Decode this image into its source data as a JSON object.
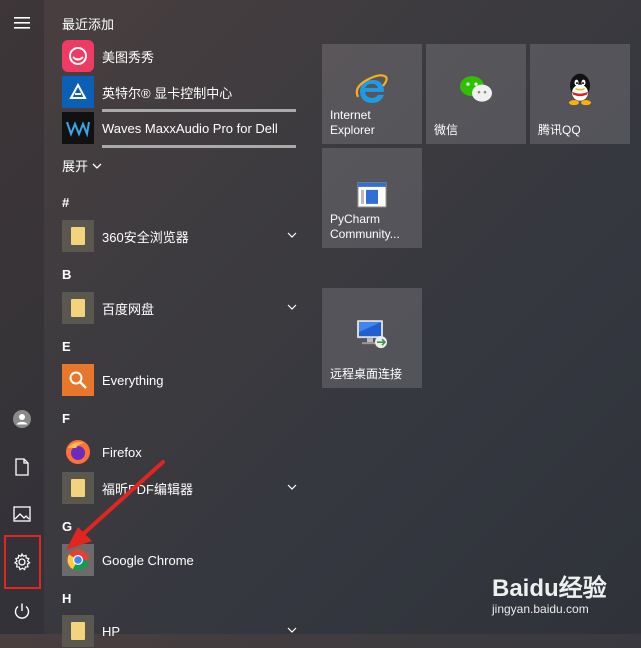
{
  "start_menu": {
    "recently_added_title": "最近添加",
    "recent_items": [
      {
        "label": "美图秀秀",
        "icon": "meitu-icon"
      },
      {
        "label": "英特尔® 显卡控制中心",
        "icon": "intel-graphics-icon"
      },
      {
        "label": "Waves MaxxAudio Pro for Dell",
        "icon": "waves-maxxaudio-icon"
      }
    ],
    "expand_label": "展开",
    "groups": [
      {
        "letter": "#",
        "items": [
          {
            "label": "360安全浏览器",
            "icon": "folder-icon",
            "has_submenu": true
          }
        ]
      },
      {
        "letter": "B",
        "items": [
          {
            "label": "百度网盘",
            "icon": "folder-icon",
            "has_submenu": true
          }
        ]
      },
      {
        "letter": "E",
        "items": [
          {
            "label": "Everything",
            "icon": "everything-icon",
            "has_submenu": false
          }
        ]
      },
      {
        "letter": "F",
        "items": [
          {
            "label": "Firefox",
            "icon": "firefox-icon",
            "has_submenu": false
          },
          {
            "label": "福昕PDF编辑器",
            "icon": "folder-icon",
            "has_submenu": true
          }
        ]
      },
      {
        "letter": "G",
        "items": [
          {
            "label": "Google Chrome",
            "icon": "chrome-icon",
            "has_submenu": false
          }
        ]
      },
      {
        "letter": "H",
        "items": [
          {
            "label": "HP",
            "icon": "folder-icon",
            "has_submenu": true
          }
        ]
      }
    ],
    "tiles": [
      {
        "label": "Internet\nExplorer",
        "icon": "internet-explorer-icon"
      },
      {
        "label": "微信",
        "icon": "wechat-icon"
      },
      {
        "label": "腾讯QQ",
        "icon": "qq-icon"
      },
      {
        "label": "PyCharm\nCommunity...",
        "icon": "pycharm-icon"
      },
      {
        "label": "远程桌面连接",
        "icon": "remote-desktop-icon"
      }
    ]
  },
  "rail": {
    "items": [
      "hamburger-menu-icon",
      "user-icon",
      "documents-icon",
      "pictures-icon",
      "settings-icon",
      "power-icon"
    ]
  },
  "watermark": {
    "brand": "Baidu经验",
    "url": "jingyan.baidu.com"
  },
  "colors": {
    "highlight": "#e0261f",
    "folder": "#f3d37b",
    "tile_bg": "rgba(255,255,255,0.14)"
  }
}
